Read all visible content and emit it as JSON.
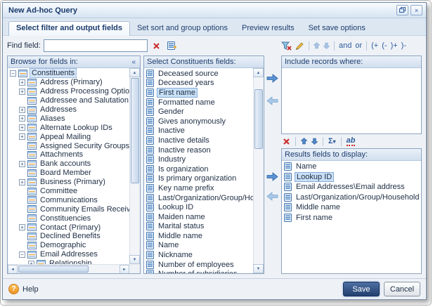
{
  "window": {
    "title": "New Ad-hoc Query",
    "close_glyph": "×"
  },
  "tabs": [
    {
      "label": "Select filter and output fields",
      "active": true
    },
    {
      "label": "Set sort and group options",
      "active": false
    },
    {
      "label": "Preview results",
      "active": false
    },
    {
      "label": "Set save options",
      "active": false
    }
  ],
  "find_bar": {
    "label": "Find field:",
    "value": ""
  },
  "browse_panel": {
    "header": "Browse for fields in:",
    "collapse_glyph": "«",
    "tree": [
      {
        "label": "Constituents",
        "level": 0,
        "box": "minus",
        "selected": true
      },
      {
        "label": "Address (Primary)",
        "level": 1,
        "box": "plus"
      },
      {
        "label": "Address Processing Options",
        "level": 1,
        "box": "plus"
      },
      {
        "label": "Addressee and Salutation",
        "level": 1,
        "box": "none"
      },
      {
        "label": "Addresses",
        "level": 1,
        "box": "plus"
      },
      {
        "label": "Aliases",
        "level": 1,
        "box": "plus"
      },
      {
        "label": "Alternate Lookup IDs",
        "level": 1,
        "box": "plus"
      },
      {
        "label": "Appeal Mailing",
        "level": 1,
        "box": "plus"
      },
      {
        "label": "Assigned Security Groups",
        "level": 1,
        "box": "none"
      },
      {
        "label": "Attachments",
        "level": 1,
        "box": "none"
      },
      {
        "label": "Bank accounts",
        "level": 1,
        "box": "plus"
      },
      {
        "label": "Board Member",
        "level": 1,
        "box": "none"
      },
      {
        "label": "Business (Primary)",
        "level": 1,
        "box": "plus"
      },
      {
        "label": "Committee",
        "level": 1,
        "box": "none"
      },
      {
        "label": "Communications",
        "level": 1,
        "box": "none"
      },
      {
        "label": "Community Emails Received",
        "level": 1,
        "box": "none"
      },
      {
        "label": "Constituencies",
        "level": 1,
        "box": "none"
      },
      {
        "label": "Contact (Primary)",
        "level": 1,
        "box": "plus"
      },
      {
        "label": "Declined Benefits",
        "level": 1,
        "box": "none"
      },
      {
        "label": "Demographic",
        "level": 1,
        "box": "none"
      },
      {
        "label": "Email Addresses",
        "level": 1,
        "box": "minus"
      },
      {
        "label": "Relationship",
        "level": 2,
        "box": "plus"
      }
    ]
  },
  "fields_panel": {
    "header": "Select Constituents fields:",
    "items": [
      {
        "label": "Deceased source"
      },
      {
        "label": "Deceased years"
      },
      {
        "label": "First name",
        "selected": true
      },
      {
        "label": "Formatted name"
      },
      {
        "label": "Gender"
      },
      {
        "label": "Gives anonymously"
      },
      {
        "label": "Inactive"
      },
      {
        "label": "Inactive details"
      },
      {
        "label": "Inactive reason"
      },
      {
        "label": "Industry"
      },
      {
        "label": "Is organization"
      },
      {
        "label": "Is primary organization"
      },
      {
        "label": "Key name prefix"
      },
      {
        "label": "Last/Organization/Group/Household name"
      },
      {
        "label": "Lookup ID"
      },
      {
        "label": "Maiden name"
      },
      {
        "label": "Marital status"
      },
      {
        "label": "Middle name"
      },
      {
        "label": "Name"
      },
      {
        "label": "Nickname"
      },
      {
        "label": "Number of employees"
      },
      {
        "label": "Number of subsidiaries"
      }
    ]
  },
  "criteria_panel": {
    "header": "Include records where:",
    "toolbar": {
      "and_label": "and",
      "or_label": "or",
      "group_labels": [
        "(+",
        "(-",
        ")+",
        ")-"
      ]
    }
  },
  "results_panel": {
    "header": "Results fields to display:",
    "toolbar": {
      "sigma_label": "Σ",
      "sigma_caret": "▾",
      "ab_label": "ab"
    },
    "items": [
      {
        "label": "Name"
      },
      {
        "label": "Lookup ID",
        "selected": true
      },
      {
        "label": "Email Addresses\\Email address"
      },
      {
        "label": "Last/Organization/Group/Household name"
      },
      {
        "label": "Middle name"
      },
      {
        "label": "First name"
      }
    ]
  },
  "footer": {
    "help_glyph": "?",
    "help_label": "Help",
    "save_label": "Save",
    "cancel_label": "Cancel"
  }
}
